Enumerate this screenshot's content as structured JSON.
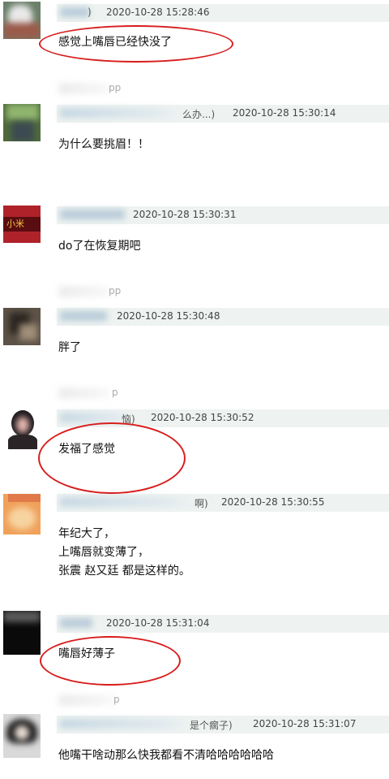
{
  "comments": [
    {
      "name_tail": ")",
      "time": "2020-10-28 15:28:46",
      "text": "感觉上嘴唇已经快没了"
    },
    {
      "name_tail": "么办...)",
      "time": "2020-10-28 15:30:14",
      "text": "为什么要挑眉！！"
    },
    {
      "name_tail": "",
      "time": "2020-10-28 15:30:31",
      "text": "do了在恢复期吧"
    },
    {
      "name_tail": "",
      "time": "2020-10-28 15:30:48",
      "text": "胖了"
    },
    {
      "name_tail": "恼)",
      "time": "2020-10-28 15:30:52",
      "text": "发福了感觉"
    },
    {
      "name_tail": "啊)",
      "time": "2020-10-28 15:30:55",
      "text": "年纪大了，\n上嘴唇就变薄了，\n张震 赵又廷 都是这样的。"
    },
    {
      "name_tail": "",
      "time": "2020-10-28 15:31:04",
      "text": "嘴唇好薄子"
    },
    {
      "name_tail": "是个瘸子)",
      "time": "2020-10-28 15:31:07",
      "text": "他嘴干啥动那么快我都看不清哈哈哈哈哈哈"
    }
  ],
  "app_suffixes": [
    "pp",
    "pp",
    "p",
    "p"
  ],
  "highlight_color": "#d81d1d"
}
